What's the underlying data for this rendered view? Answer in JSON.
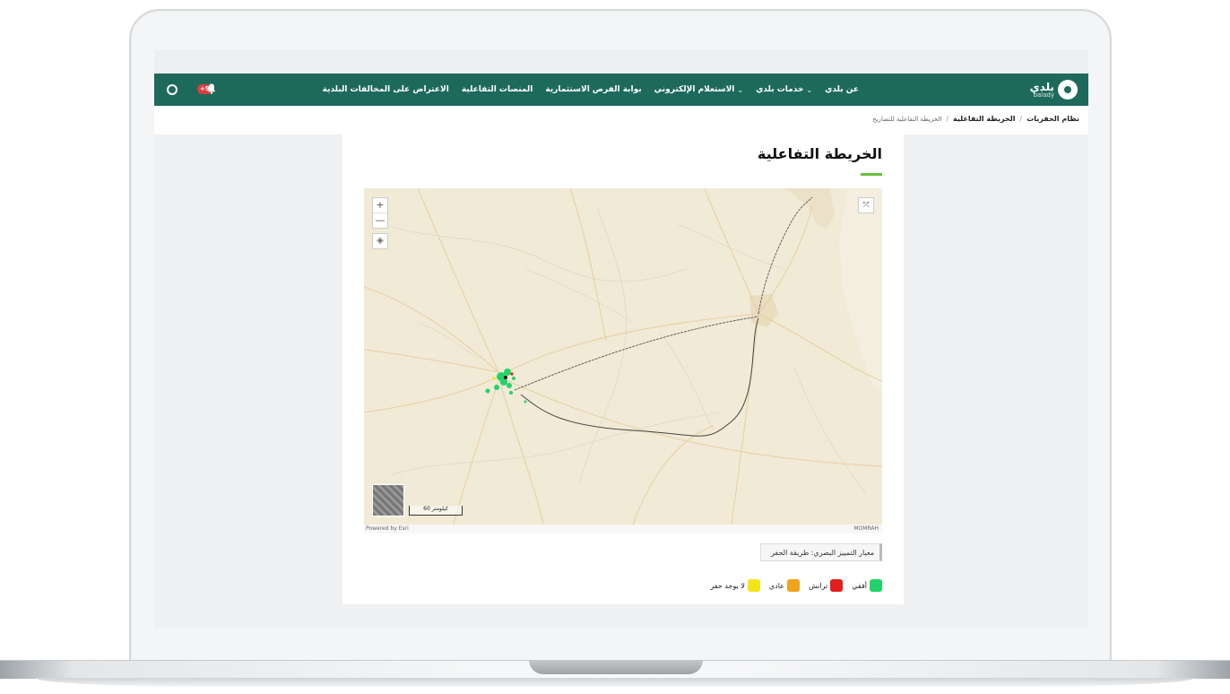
{
  "nav": {
    "logo_ar": "بلدي",
    "logo_en": "balady",
    "items": [
      {
        "label": "عن بلدي",
        "dropdown": false
      },
      {
        "label": "خدمات بلدي",
        "dropdown": true
      },
      {
        "label": "الاستعلام الإلكتروني",
        "dropdown": true
      },
      {
        "label": "بوابة الفرص الاستثمارية",
        "dropdown": false
      },
      {
        "label": "المنصات التفاعلية",
        "dropdown": false
      },
      {
        "label": "الاعتراض على المخالفات البلدية",
        "dropdown": false
      }
    ],
    "notification_badge": "+9",
    "colors": {
      "bar": "#1d6a5c",
      "badge": "#e23b3b"
    }
  },
  "breadcrumb": {
    "root": "نظام الحفريات",
    "section": "الخريطة التفاعلية",
    "current": "الخريطة التفاعلية للتصاريح"
  },
  "page": {
    "title": "الخريطة التفاعلية",
    "accent": "#6abf3f"
  },
  "map": {
    "zoom_in": "+",
    "zoom_out": "—",
    "scale_label": "60 كيلومتر",
    "attribution_left": "Powered by Esri",
    "attribution_right": "MOMRAH"
  },
  "criteria": {
    "label": "معيار التمييز البصري: طريقة الحفر"
  },
  "legend": [
    {
      "label": "أفقي",
      "color": "#22d36a"
    },
    {
      "label": "ترانش",
      "color": "#e0201e"
    },
    {
      "label": "عادي",
      "color": "#f2a21b"
    },
    {
      "label": "لا يوجد حفر",
      "color": "#f4e51a"
    }
  ]
}
